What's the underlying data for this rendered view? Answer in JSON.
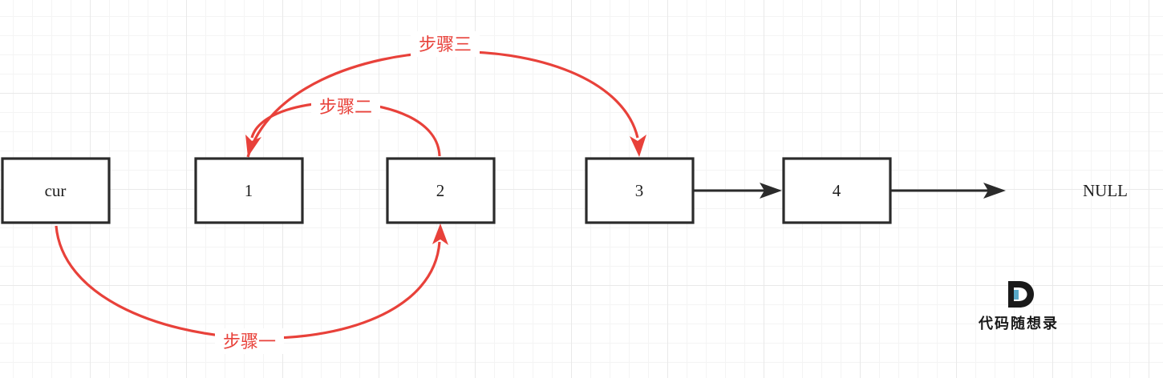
{
  "nodes": {
    "cur": "cur",
    "n1": "1",
    "n2": "2",
    "n3": "3",
    "n4": "4"
  },
  "null_label": "NULL",
  "steps": {
    "one": "步骤一",
    "two": "步骤二",
    "three": "步骤三"
  },
  "watermark": {
    "text": "代码随想录",
    "logo_colors": [
      "#1a1a1a",
      "#5aa9c8"
    ]
  },
  "colors": {
    "node_border": "#2b2b2b",
    "step_arrow": "#e8413a",
    "next_arrow": "#2b2b2b"
  }
}
